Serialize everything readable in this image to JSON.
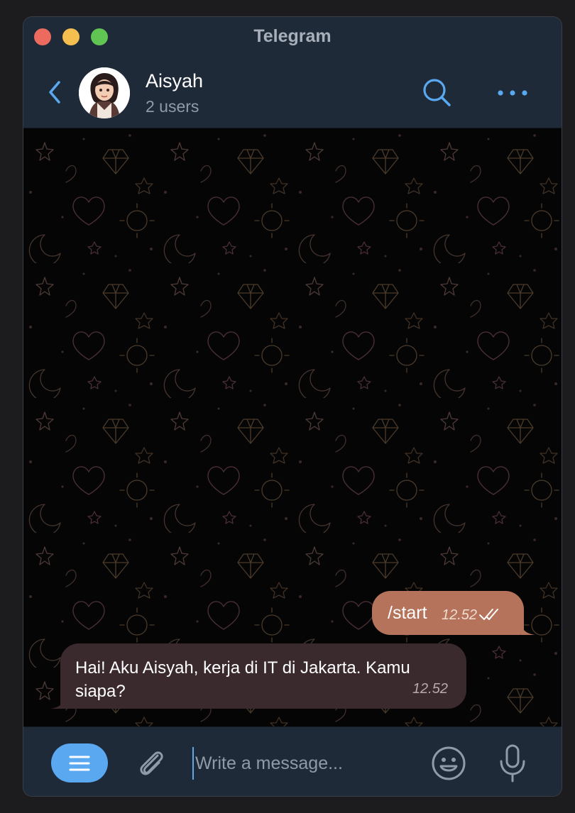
{
  "window": {
    "title": "Telegram"
  },
  "header": {
    "name": "Aisyah",
    "subtitle": "2 users",
    "avatar_caption": "Aisyah"
  },
  "messages": [
    {
      "direction": "outgoing",
      "text": "/start",
      "time": "12.52",
      "status": "read"
    },
    {
      "direction": "incoming",
      "text": "Hai! Aku Aisyah, kerja di IT di Jakarta. Kamu siapa?",
      "time": "12.52"
    }
  ],
  "composer": {
    "placeholder": "Write a message..."
  },
  "icons": {
    "back": "chevron-left-icon",
    "search": "search-icon",
    "more": "more-horizontal-icon",
    "menu": "menu-icon",
    "attach": "paperclip-icon",
    "emoji": "smiley-icon",
    "mic": "microphone-icon"
  },
  "colors": {
    "accent": "#5aa8f0",
    "outgoing_bubble": "#b4735a",
    "incoming_bubble": "#3a2a2e",
    "header_bg": "#1f2a38",
    "chat_bg": "#050505"
  }
}
